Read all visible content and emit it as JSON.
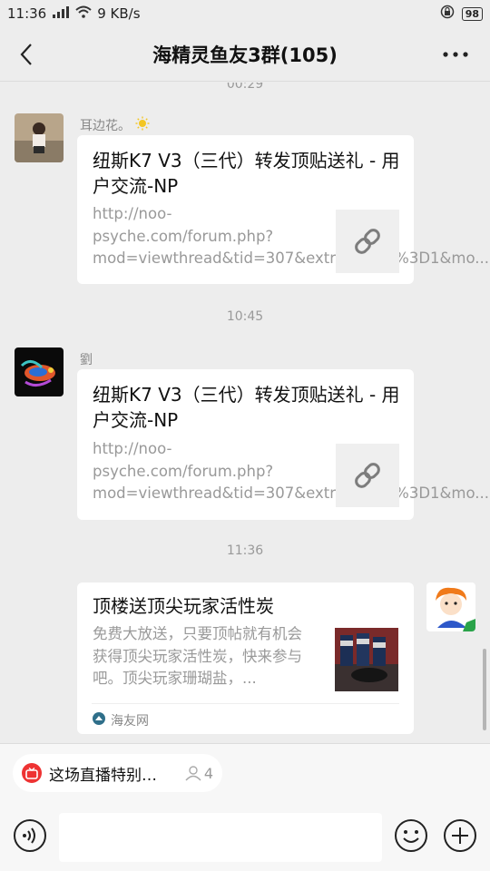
{
  "status": {
    "time": "11:36",
    "network": "9 KB/s",
    "battery": "98"
  },
  "header": {
    "title": "海精灵鱼友3群(105)"
  },
  "chat": {
    "prev_time_partial": "00:29",
    "messages": [
      {
        "sender": "耳边花。",
        "title": "纽斯K7 V3（三代）转发顶贴送礼 - 用户交流-NP",
        "desc": "http://noo-psyche.com/forum.php?mod=viewthread&tid=307&extra=page%3D1&mo..."
      },
      {
        "time": "10:45",
        "sender": "劉",
        "title": "纽斯K7 V3（三代）转发顶贴送礼 - 用户交流-NP",
        "desc": "http://noo-psyche.com/forum.php?mod=viewthread&tid=307&extra=page%3D1&mo..."
      },
      {
        "time": "11:36",
        "title": "顶楼送顶尖玩家活性炭",
        "desc": "免费大放送，只要顶帖就有机会获得顶尖玩家活性炭，快来参与吧。顶尖玩家珊瑚盐，...",
        "source": "海友网"
      }
    ]
  },
  "live": {
    "text": "这场直播特别…",
    "viewers": "4"
  },
  "colors": {
    "background": "#ededed",
    "bubble": "#ffffff",
    "accent_live": "#e33333"
  }
}
